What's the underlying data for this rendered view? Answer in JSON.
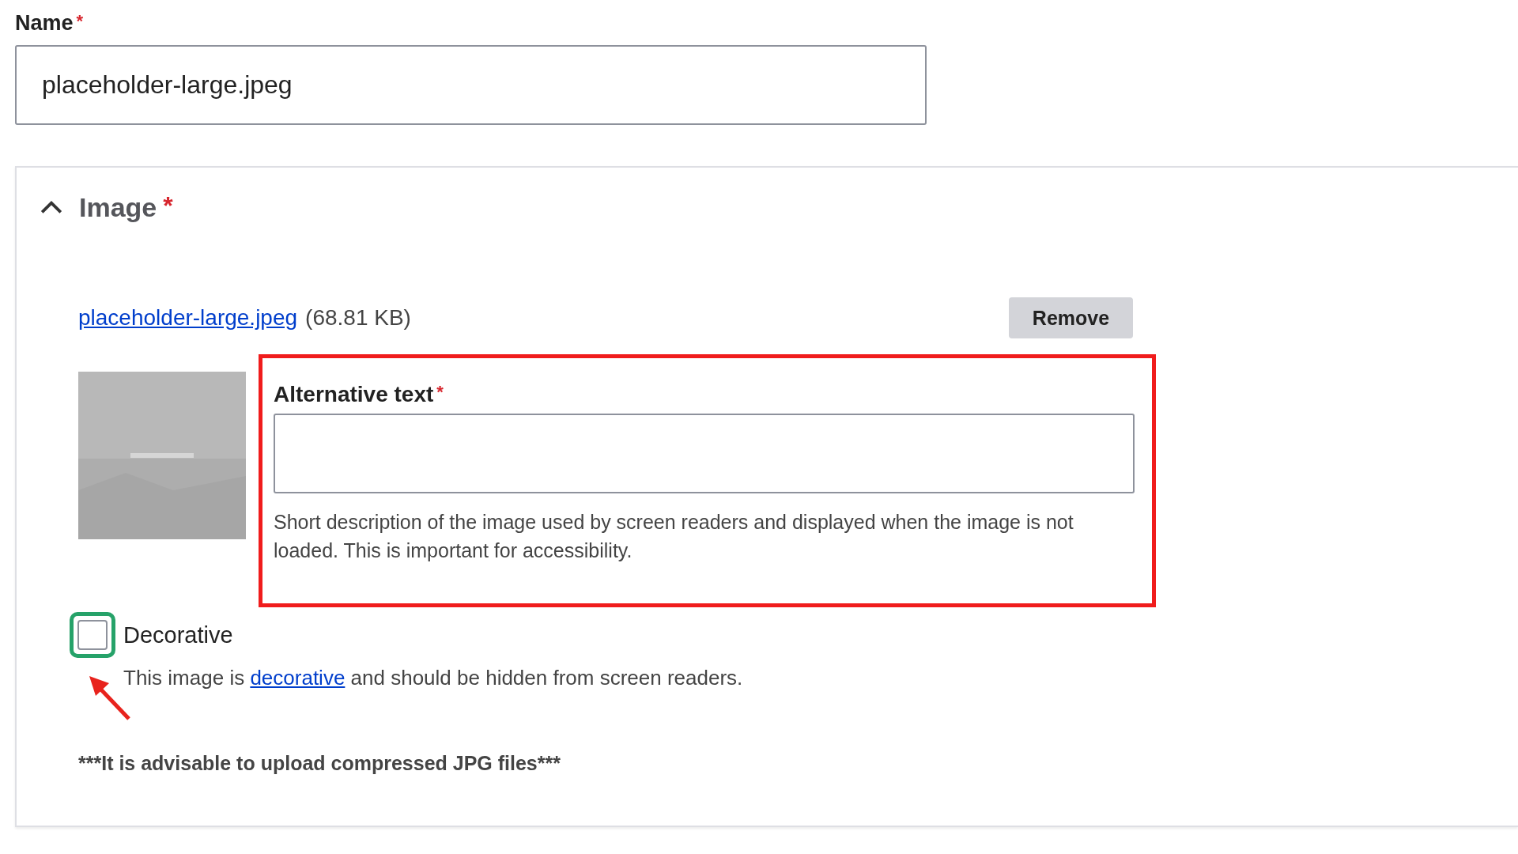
{
  "name_field": {
    "label": "Name",
    "required_mark": "*",
    "value": "placeholder-large.jpeg"
  },
  "image_panel": {
    "title": "Image",
    "required_mark": "*",
    "expanded": true,
    "file": {
      "link": "placeholder-large.jpeg",
      "size": "(68.81 KB)"
    },
    "remove_button": "Remove",
    "alt_text": {
      "label": "Alternative text",
      "required_mark": "*",
      "highlighted": true,
      "description": "Short description of the image used by screen readers and displayed when the image is not loaded. This is important for accessibility."
    },
    "decorative": {
      "label": "Decorative",
      "checked": false,
      "focused": true,
      "pointed_at": true,
      "text_before": "This image is",
      "link": "decorative",
      "text_after": "and should be hidden from screen readers."
    },
    "note": "***It is advisable to upload compressed JPG files***"
  }
}
